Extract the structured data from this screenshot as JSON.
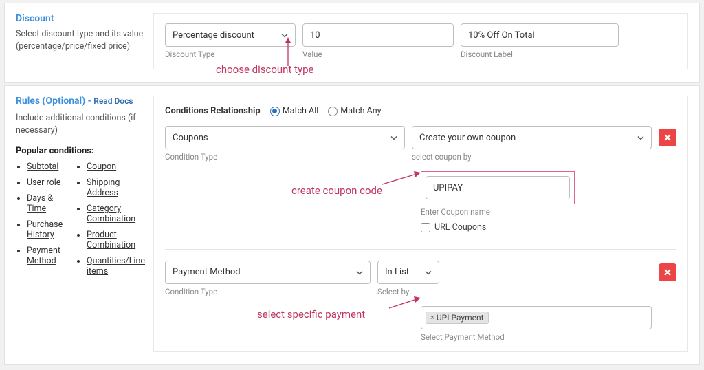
{
  "discount": {
    "title": "Discount",
    "desc": "Select discount type and its value (percentage/price/fixed price)",
    "type_value": "Percentage discount",
    "type_label": "Discount Type",
    "value_value": "10",
    "value_label": "Value",
    "label_value": "10% Off On Total",
    "label_label": "Discount Label",
    "anno": "choose discount type"
  },
  "rules": {
    "title": "Rules (Optional) - ",
    "docs": "Read Docs",
    "desc": "Include additional conditions (if necessary)",
    "pop_head": "Popular conditions:",
    "pop_col1": [
      "Subtotal",
      "User role",
      "Days & Time",
      "Purchase History",
      "Payment Method"
    ],
    "pop_col2": [
      "Coupon",
      "Shipping Address",
      "Category Combination",
      "Product Combination",
      "Quantities/Line items"
    ],
    "cond_rel_label": "Conditions Relationship",
    "match_all": "Match All",
    "match_any": "Match Any",
    "conditions": [
      {
        "type_value": "Coupons",
        "type_label": "Condition Type",
        "by_value": "Create your own coupon",
        "by_label": "select coupon by",
        "coupon_value": "UPIPAY",
        "coupon_label": "Enter Coupon name",
        "url_coupons": "URL Coupons",
        "anno": "create coupon code"
      },
      {
        "type_value": "Payment Method",
        "type_label": "Condition Type",
        "op_value": "In List",
        "op_label": "Select by",
        "tags": [
          "UPI Payment"
        ],
        "sel_label": "Select Payment Method",
        "anno": "select specific payment"
      }
    ]
  }
}
